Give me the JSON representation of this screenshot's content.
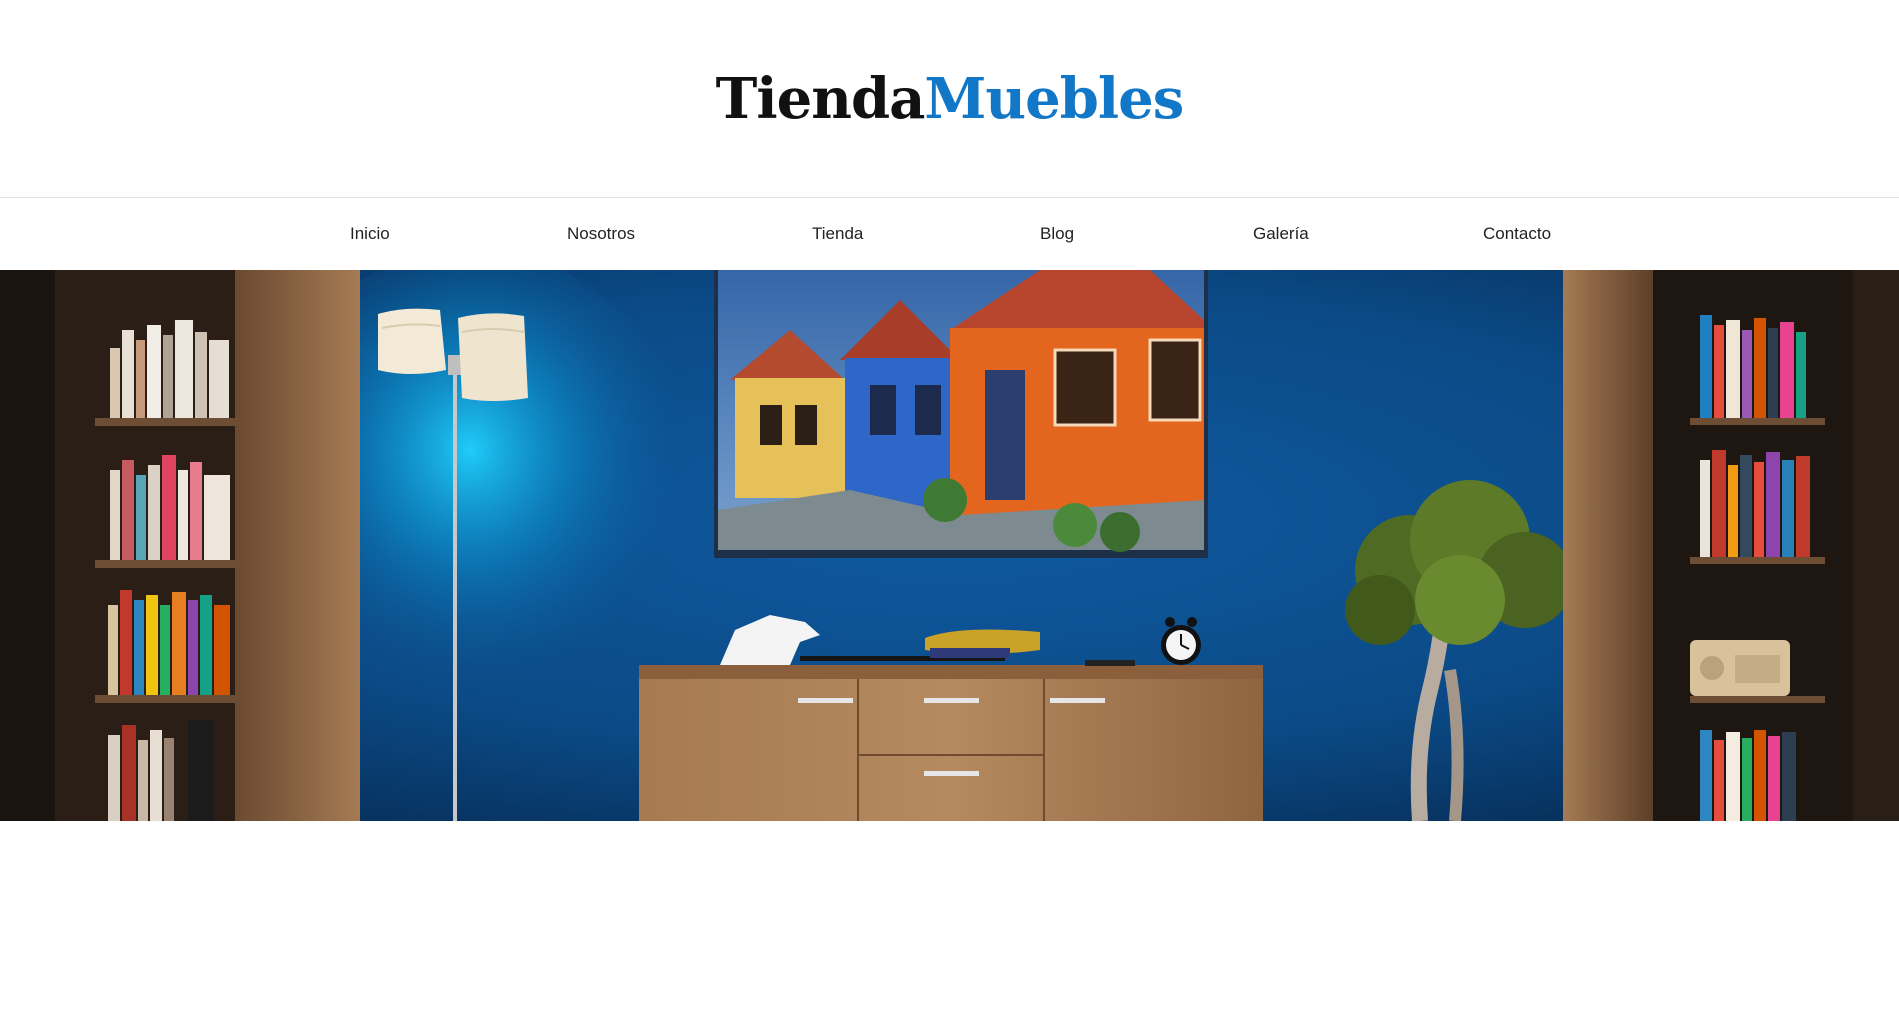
{
  "header": {
    "logo_part_a": "Tienda",
    "logo_part_b": "Muebles",
    "logo_colors": {
      "part_a": "#111111",
      "part_b": "#1277c6"
    }
  },
  "nav": {
    "items": [
      {
        "label": "Inicio"
      },
      {
        "label": "Nosotros"
      },
      {
        "label": "Tienda"
      },
      {
        "label": "Blog"
      },
      {
        "label": "Galería"
      },
      {
        "label": "Contacto"
      }
    ]
  },
  "hero": {
    "image": "living-room-hero-image",
    "dominant_colors": {
      "wall": "#0b4a86",
      "wood": "#9c6f48",
      "lamp_glow": "#12b8e6"
    }
  }
}
